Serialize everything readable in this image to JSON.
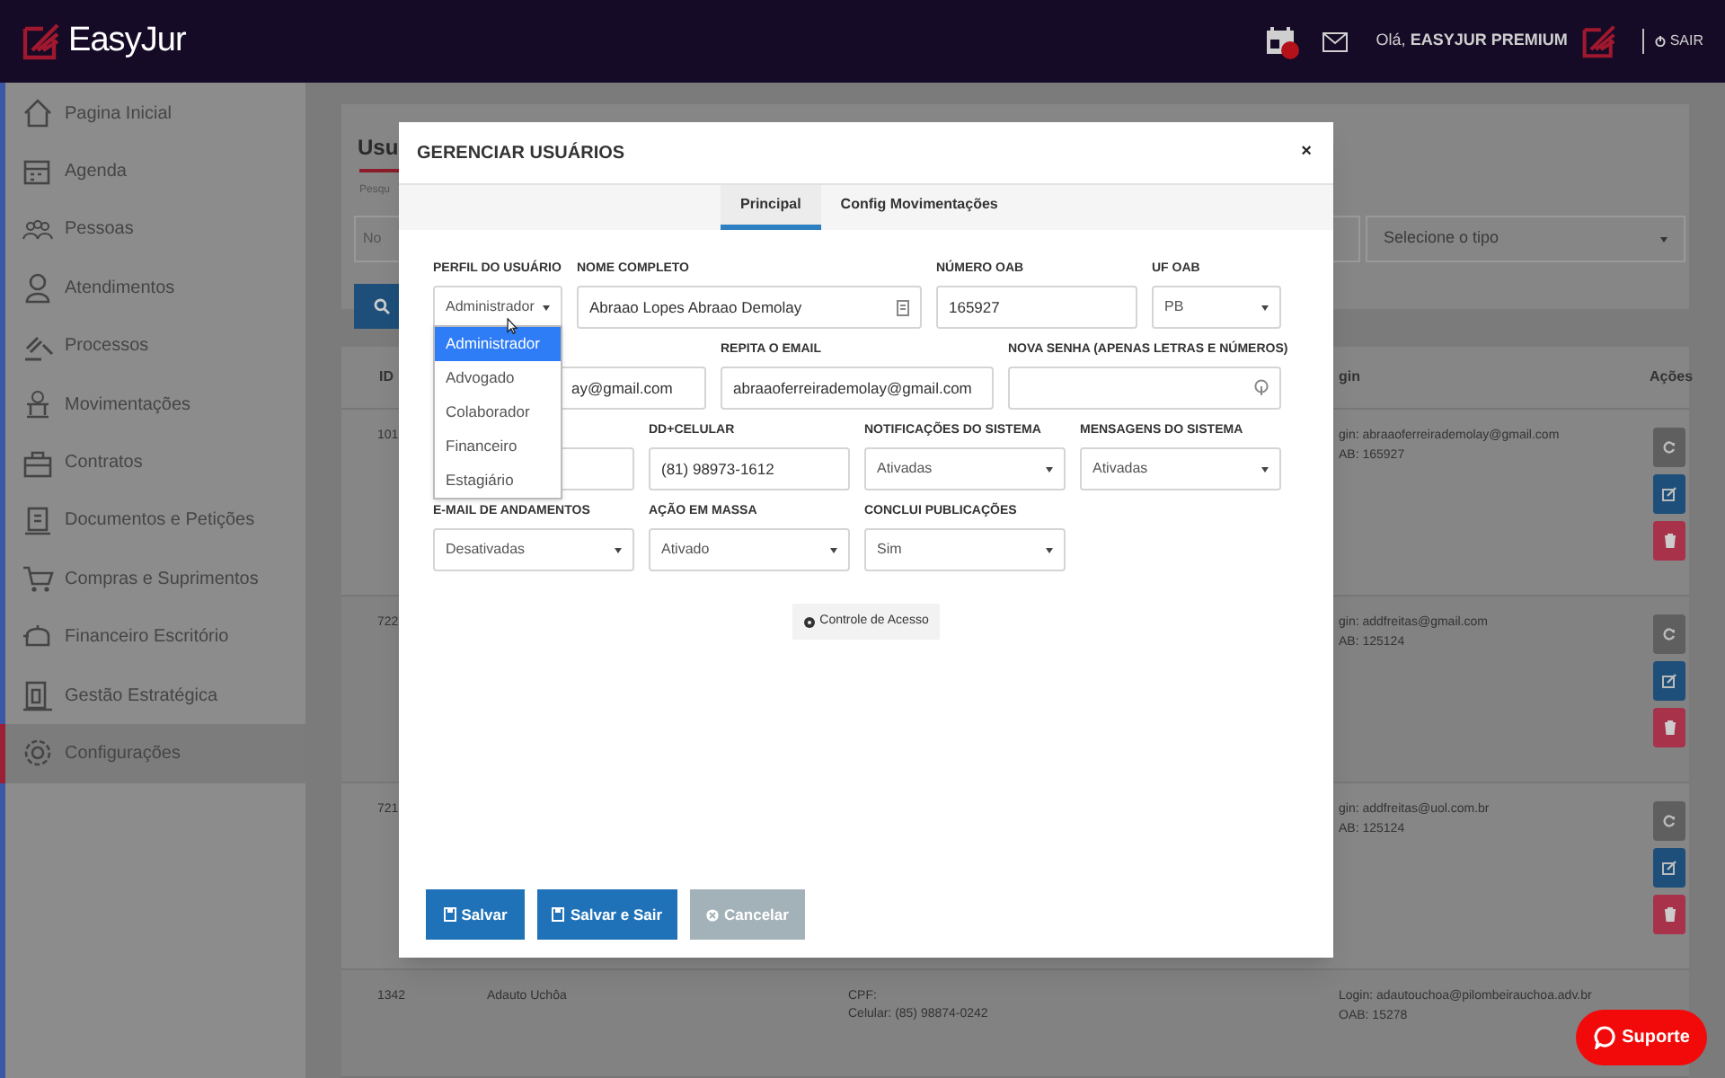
{
  "header": {
    "logo": "EasyJur",
    "greeting_prefix": "Olá,",
    "greeting_name": "EASYJUR PREMIUM",
    "logout": "SAIR"
  },
  "sidebar": {
    "items": [
      {
        "label": "Pagina Inicial",
        "selected": false
      },
      {
        "label": "Agenda",
        "selected": false
      },
      {
        "label": "Pessoas",
        "selected": false
      },
      {
        "label": "Atendimentos",
        "selected": false
      },
      {
        "label": "Processos",
        "selected": false
      },
      {
        "label": "Movimentações",
        "selected": false
      },
      {
        "label": "Contratos",
        "selected": false
      },
      {
        "label": "Documentos e Petições",
        "selected": false
      },
      {
        "label": "Compras e Suprimentos",
        "selected": false
      },
      {
        "label": "Financeiro Escritório",
        "selected": false
      },
      {
        "label": "Gestão Estratégica",
        "selected": false
      },
      {
        "label": "Configurações",
        "selected": true
      }
    ]
  },
  "page": {
    "title": "Usu",
    "search_label": "Pesqu",
    "search_placeholder": "No",
    "type_select": "Selecione o tipo"
  },
  "table": {
    "columns": [
      "ID",
      "gin",
      "Ações"
    ],
    "rows": [
      {
        "id": "101",
        "login": "gin: abraaoferreirademolay@gmail.com",
        "oab": "AB: 165927"
      },
      {
        "id": "722",
        "login": "gin: addfreitas@gmail.com",
        "oab": "AB: 125124"
      },
      {
        "id": "721",
        "login": "gin: addfreitas@uol.com.br",
        "oab": "AB: 125124"
      },
      {
        "id": "1342",
        "name": "Adauto Uchôa",
        "cpf": "CPF:",
        "celular": "Celular: (85) 98874-0242",
        "login": "Login: adautouchoa@pilombeirauchoa.adv.br",
        "oab": "OAB: 15278"
      }
    ]
  },
  "modal": {
    "title": "GERENCIAR USUÁRIOS",
    "close": "×",
    "tabs": [
      {
        "label": "Principal",
        "selected": true
      },
      {
        "label": "Config Movimentações",
        "selected": false
      }
    ],
    "form_rows": [
      [
        {
          "kind": "select",
          "label": "PERFIL DO USUÁRIO",
          "value": "Administrador"
        },
        {
          "kind": "id_text",
          "label": "NOME COMPLETO",
          "value": "Abraao Lopes Abraao Demolay"
        },
        {
          "kind": "text",
          "label": "NÚMERO OAB",
          "value": "165927"
        },
        {
          "kind": "select",
          "label": "UF OAB",
          "value": "PB"
        }
      ],
      [
        {
          "kind": "text",
          "value": "ay@gmail.com"
        },
        {
          "kind": "text",
          "label": "REPITA O EMAIL",
          "value": "abraaoferreirademolay@gmail.com"
        },
        {
          "kind": "password",
          "label": "NOVA SENHA (APENAS LETRAS E NÚMEROS)"
        }
      ],
      [
        {
          "kind": "text"
        },
        {
          "kind": "text",
          "label": "DD+CELULAR",
          "value": "(81) 98973-1612"
        },
        {
          "kind": "select",
          "label": "NOTIFICAÇÕES DO SISTEMA",
          "value": "Ativadas"
        },
        {
          "kind": "select",
          "label": "MENSAGENS DO SISTEMA",
          "value": "Ativadas"
        }
      ],
      [
        {
          "kind": "select",
          "label": "E-MAIL DE ANDAMENTOS",
          "value": "Desativadas"
        },
        {
          "kind": "select",
          "label": "AÇÃO EM MASSA",
          "value": "Ativado"
        },
        {
          "kind": "select",
          "label": "CONCLUI PUBLICAÇÕES",
          "value": "Sim"
        }
      ]
    ],
    "dropdown": [
      {
        "label": "Administrador",
        "selected": true
      },
      {
        "label": "Advogado",
        "selected": false
      },
      {
        "label": "Colaborador",
        "selected": false
      },
      {
        "label": "Financeiro",
        "selected": false
      },
      {
        "label": "Estagiário",
        "selected": false
      }
    ],
    "access_button": "Controle de Acesso",
    "buttons": [
      {
        "kind": "primary",
        "label": "Salvar"
      },
      {
        "kind": "primary",
        "label": "Salvar e Sair"
      },
      {
        "kind": "cancel",
        "label": "Cancelar"
      }
    ]
  },
  "support": "Suporte"
}
